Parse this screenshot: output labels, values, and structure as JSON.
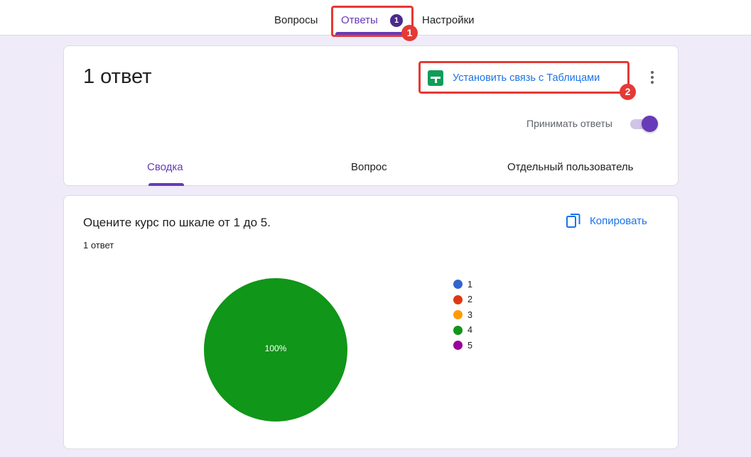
{
  "nav": {
    "tabs": [
      "Вопросы",
      "Ответы",
      "Настройки"
    ],
    "responses_badge": "1",
    "active_tab": "Ответы"
  },
  "annotations": [
    "1",
    "2"
  ],
  "header_card": {
    "title": "1 ответ",
    "sheets_link_label": "Установить связь с Таблицами",
    "accept_responses_label": "Принимать ответы",
    "accept_responses_on": true,
    "view_tabs": [
      "Сводка",
      "Вопрос",
      "Отдельный пользователь"
    ],
    "active_view_tab": "Сводка"
  },
  "question_card": {
    "question": "Оцените курс по шкале от 1 до 5.",
    "response_count": "1 ответ",
    "copy_label": "Копировать"
  },
  "chart_data": {
    "type": "pie",
    "categories": [
      "1",
      "2",
      "3",
      "4",
      "5"
    ],
    "values": [
      0,
      0,
      0,
      100,
      0
    ],
    "colors": [
      "#3366cc",
      "#dc3912",
      "#ff9900",
      "#109618",
      "#990099"
    ],
    "slice_label": "100%",
    "legend_position": "right"
  },
  "colors": {
    "accent": "#673ab7",
    "link": "#1a73e8",
    "highlight": "#e53935",
    "background": "#f0ebf8"
  }
}
